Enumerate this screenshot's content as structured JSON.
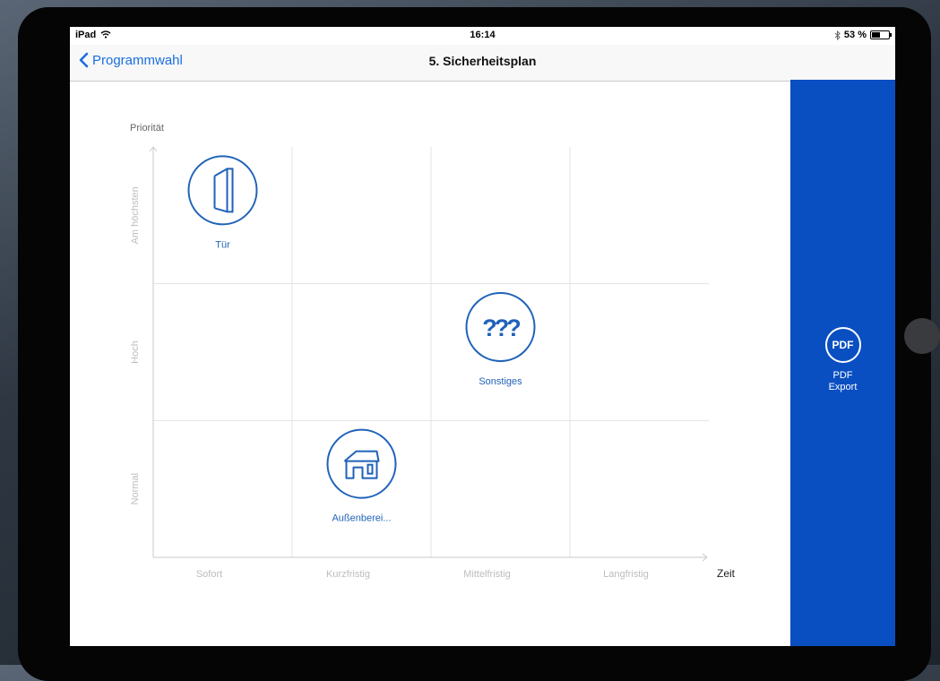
{
  "status_bar": {
    "device": "iPad",
    "time": "16:14",
    "battery": "53 %"
  },
  "nav_bar": {
    "back_label": "Programmwahl",
    "title": "5. Sicherheitsplan"
  },
  "chart_data": {
    "type": "scatter",
    "ylabel": "Priorität",
    "xlabel": "Zeit",
    "x_categories": [
      "Sofort",
      "Kurzfristig",
      "Mittelfristig",
      "Langfristig"
    ],
    "y_categories": [
      "Normal",
      "Hoch",
      "Am höchsten"
    ],
    "grid": true,
    "points": [
      {
        "label": "Tür",
        "x": "Sofort",
        "y": "Am höchsten",
        "icon": "door-icon"
      },
      {
        "label": "Sonstiges",
        "x": "Mittelfristig",
        "y": "Hoch",
        "icon": "question-marks-icon"
      },
      {
        "label": "Außenberei...",
        "x": "Kurzfristig",
        "y": "Normal",
        "icon": "house-icon"
      }
    ]
  },
  "side_panel": {
    "pdf_icon_text": "PDF",
    "pdf_label_line1": "PDF",
    "pdf_label_line2": "Export"
  },
  "colors": {
    "accent": "#0a4fc2",
    "icon_blue": "#1f62b8",
    "link_blue": "#1a6fe0"
  }
}
